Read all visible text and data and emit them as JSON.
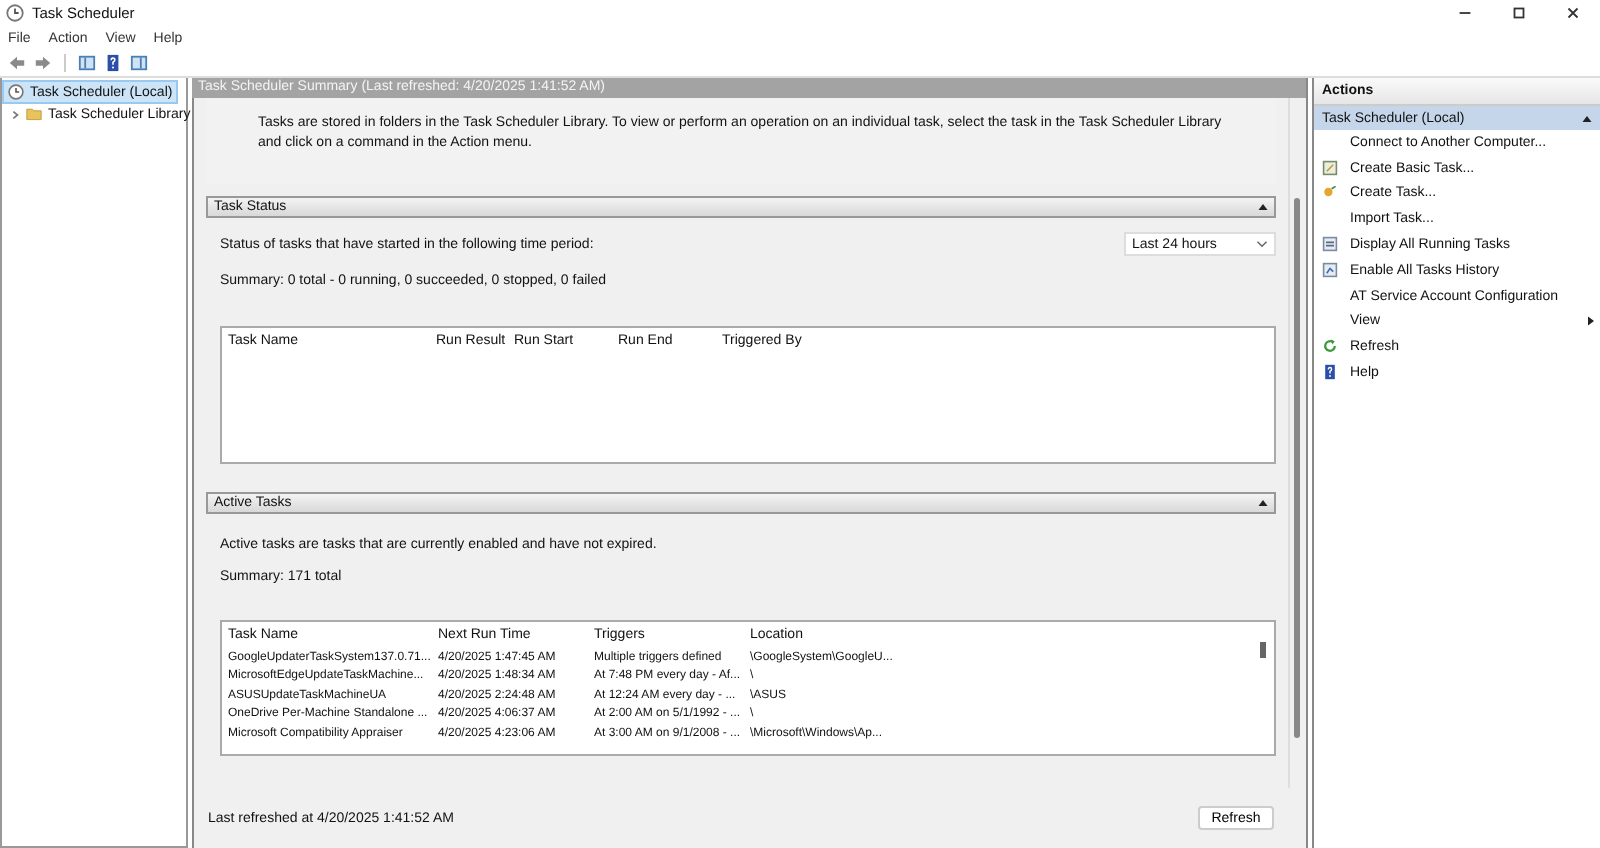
{
  "window": {
    "title": "Task Scheduler"
  },
  "menu": [
    "File",
    "Action",
    "View",
    "Help"
  ],
  "tree": [
    {
      "label": "Task Scheduler (Local)",
      "selected": true,
      "expanded": true,
      "children": [
        {
          "label": "Task Scheduler Library",
          "selected": false,
          "expanded": false
        }
      ]
    }
  ],
  "summary": {
    "header": "Task Scheduler Summary (Last refreshed: 4/20/2025 1:41:52 AM)",
    "intro": "Tasks are stored in folders in the Task Scheduler Library. To view or perform an operation on an individual task, select the task in the Task Scheduler Library and click on a command in the Action menu.",
    "task_status": {
      "title": "Task Status",
      "prompt": "Status of tasks that have started in the following time period:",
      "period": "Last 24 hours",
      "summary": "Summary: 0 total - 0 running, 0 succeeded, 0 stopped, 0 failed",
      "columns": [
        "Task Name",
        "Run Result",
        "Run Start",
        "Run End",
        "Triggered By"
      ]
    },
    "active_tasks": {
      "title": "Active Tasks",
      "description": "Active tasks are tasks that are currently enabled and have not expired.",
      "summary": "Summary: 171 total",
      "columns": [
        "Task Name",
        "Next Run Time",
        "Triggers",
        "Location"
      ],
      "rows": [
        [
          "GoogleUpdaterTaskSystem137.0.71...",
          "4/20/2025 1:47:45 AM",
          "Multiple triggers defined",
          "\\GoogleSystem\\GoogleU..."
        ],
        [
          "MicrosoftEdgeUpdateTaskMachine...",
          "4/20/2025 1:48:34 AM",
          "At 7:48 PM every day - Af...",
          "\\"
        ],
        [
          "ASUSUpdateTaskMachineUA",
          "4/20/2025 2:24:48 AM",
          "At 12:24 AM every day - ...",
          "\\ASUS"
        ],
        [
          "OneDrive Per-Machine Standalone ...",
          "4/20/2025 4:06:37 AM",
          "At 2:00 AM on 5/1/1992 - ...",
          "\\"
        ],
        [
          "Microsoft Compatibility Appraiser",
          "4/20/2025 4:23:06 AM",
          "At 3:00 AM on 9/1/2008 - ...",
          "\\Microsoft\\Windows\\Ap..."
        ]
      ]
    },
    "footer": "Last refreshed at 4/20/2025 1:41:52 AM",
    "refresh_button": "Refresh"
  },
  "actions": {
    "title": "Actions",
    "group": "Task Scheduler (Local)",
    "expanded": true,
    "items": [
      {
        "label": "Connect to Another Computer..."
      },
      {
        "label": "Create Basic Task..."
      },
      {
        "label": "Create Task..."
      },
      {
        "label": "Import Task..."
      },
      {
        "label": "Display All Running Tasks"
      },
      {
        "label": "Enable All Tasks History"
      },
      {
        "label": "AT Service Account Configuration"
      },
      {
        "label": "View",
        "kind": "submenu"
      },
      {
        "label": "Refresh"
      },
      {
        "label": "Help"
      }
    ]
  }
}
